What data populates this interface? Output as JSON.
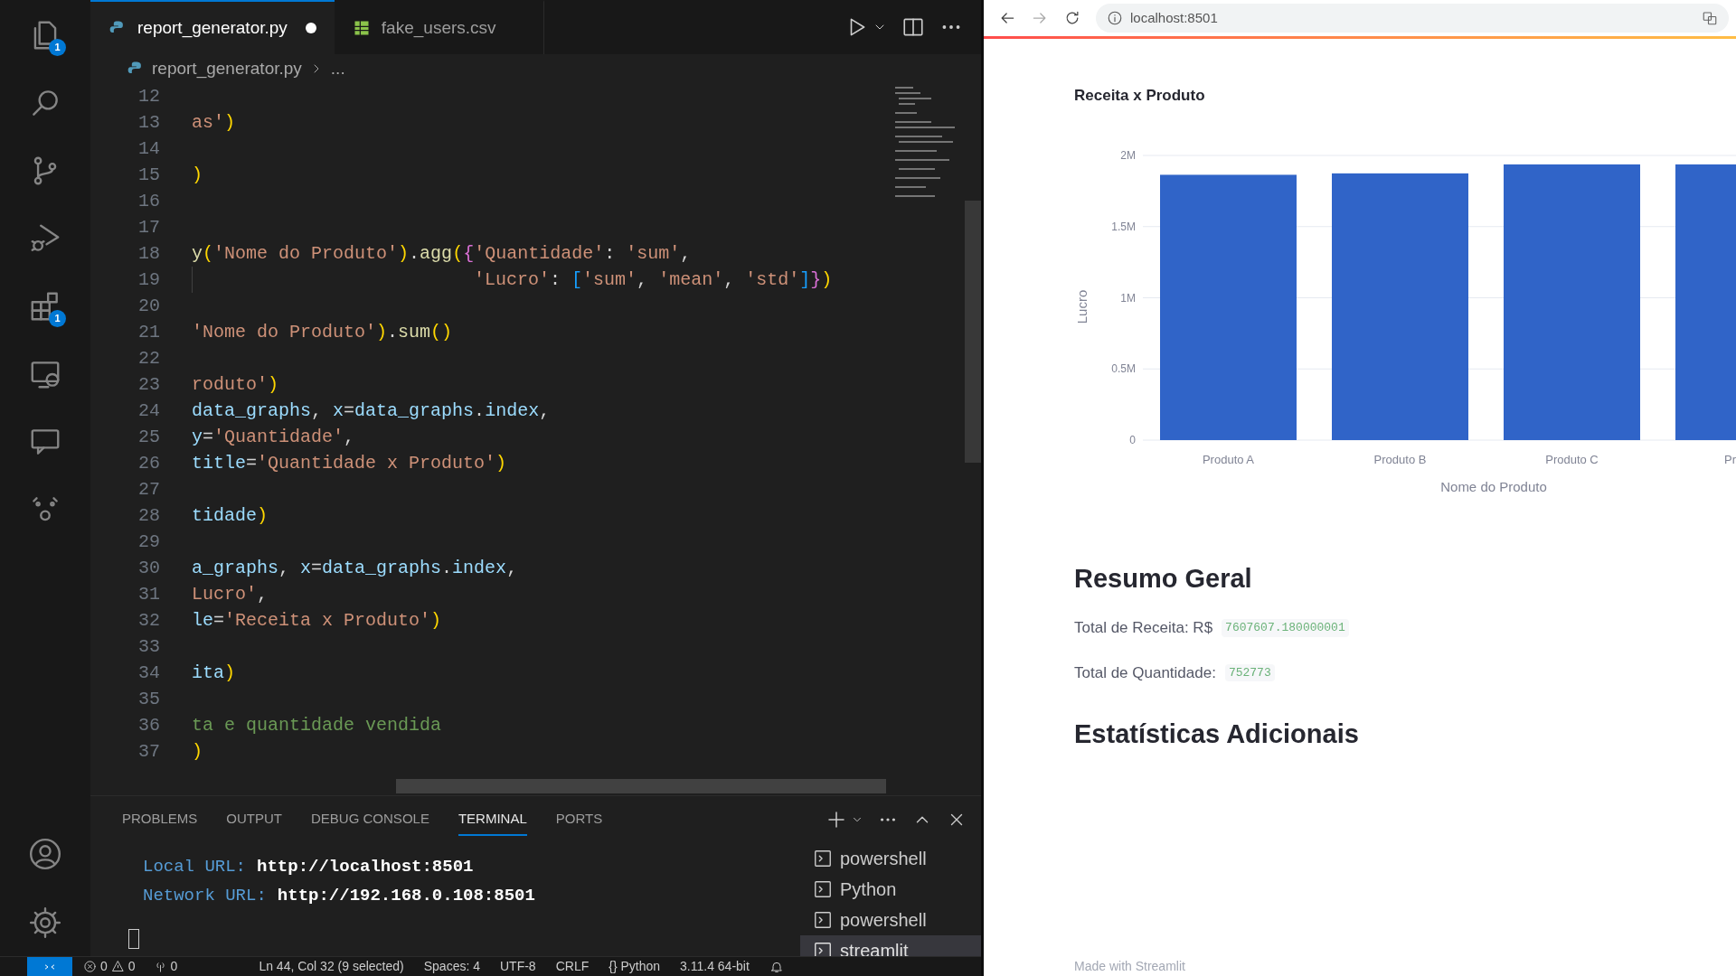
{
  "activity_bar": {
    "top": [
      {
        "kind": "explorer",
        "badge": "1"
      },
      {
        "kind": "search"
      },
      {
        "kind": "source-control"
      },
      {
        "kind": "run-debug"
      },
      {
        "kind": "extensions",
        "badge": "1"
      },
      {
        "kind": "remote"
      },
      {
        "kind": "chat"
      },
      {
        "kind": "bot"
      }
    ],
    "bottom": [
      {
        "kind": "account"
      },
      {
        "kind": "settings"
      }
    ]
  },
  "editor_tabs": [
    {
      "label": "report_generator.py",
      "kind": "python",
      "selected": true,
      "modified": true
    },
    {
      "label": "fake_users.csv",
      "kind": "csv",
      "selected": false,
      "modified": false
    }
  ],
  "breadcrumb": {
    "file": "report_generator.py",
    "rest": "..."
  },
  "code_lines": [
    {
      "number": "12"
    },
    {
      "number": "13",
      "tokens": [
        {
          "text": "as'",
          "kind": "string"
        },
        {
          "text": ")",
          "kind": "paren"
        }
      ]
    },
    {
      "number": "14"
    },
    {
      "number": "15",
      "tokens": [
        {
          "text": ")",
          "kind": "paren"
        }
      ]
    },
    {
      "number": "16"
    },
    {
      "number": "17"
    },
    {
      "number": "18",
      "tokens": [
        {
          "text": "y",
          "kind": "func"
        },
        {
          "text": "(",
          "kind": "paren"
        },
        {
          "text": "'Nome do Produto'",
          "kind": "string"
        },
        {
          "text": ")",
          "kind": "paren"
        },
        {
          "text": ".",
          "kind": "punct"
        },
        {
          "text": "agg",
          "kind": "func"
        },
        {
          "text": "(",
          "kind": "paren"
        },
        {
          "text": "{",
          "kind": "brace"
        },
        {
          "text": "'Quantidade'",
          "kind": "string"
        },
        {
          "text": ": ",
          "kind": "punct"
        },
        {
          "text": "'sum'",
          "kind": "string"
        },
        {
          "text": ",",
          "kind": "punct"
        }
      ]
    },
    {
      "number": "19",
      "continuation": true,
      "tokens": [
        {
          "text": "'Lucro'",
          "kind": "string"
        },
        {
          "text": ": ",
          "kind": "punct"
        },
        {
          "text": "[",
          "kind": "bracket"
        },
        {
          "text": "'sum'",
          "kind": "string"
        },
        {
          "text": ", ",
          "kind": "punct"
        },
        {
          "text": "'mean'",
          "kind": "string"
        },
        {
          "text": ", ",
          "kind": "punct"
        },
        {
          "text": "'std'",
          "kind": "string"
        },
        {
          "text": "]",
          "kind": "bracket"
        },
        {
          "text": "}",
          "kind": "brace"
        },
        {
          "text": ")",
          "kind": "paren"
        }
      ]
    },
    {
      "number": "20"
    },
    {
      "number": "21",
      "tokens": [
        {
          "text": "'Nome do Produto'",
          "kind": "string"
        },
        {
          "text": ")",
          "kind": "paren"
        },
        {
          "text": ".",
          "kind": "punct"
        },
        {
          "text": "sum",
          "kind": "func"
        },
        {
          "text": "()",
          "kind": "paren"
        }
      ]
    },
    {
      "number": "22"
    },
    {
      "number": "23",
      "tokens": [
        {
          "text": "roduto'",
          "kind": "string"
        },
        {
          "text": ")",
          "kind": "paren"
        }
      ]
    },
    {
      "number": "24",
      "tokens": [
        {
          "text": "data_graphs",
          "kind": "var"
        },
        {
          "text": ", ",
          "kind": "punct"
        },
        {
          "text": "x",
          "kind": "var"
        },
        {
          "text": "=",
          "kind": "punct"
        },
        {
          "text": "data_graphs",
          "kind": "var"
        },
        {
          "text": ".",
          "kind": "punct"
        },
        {
          "text": "index",
          "kind": "var"
        },
        {
          "text": ",",
          "kind": "punct"
        }
      ]
    },
    {
      "number": "25",
      "tokens": [
        {
          "text": "y",
          "kind": "var"
        },
        {
          "text": "=",
          "kind": "punct"
        },
        {
          "text": "'Quantidade'",
          "kind": "string"
        },
        {
          "text": ",",
          "kind": "punct"
        }
      ]
    },
    {
      "number": "26",
      "tokens": [
        {
          "text": "title",
          "kind": "var"
        },
        {
          "text": "=",
          "kind": "punct"
        },
        {
          "text": "'Quantidade x Produto'",
          "kind": "string"
        },
        {
          "text": ")",
          "kind": "paren"
        }
      ]
    },
    {
      "number": "27"
    },
    {
      "number": "28",
      "tokens": [
        {
          "text": "tidade",
          "kind": "var"
        },
        {
          "text": ")",
          "kind": "paren"
        }
      ]
    },
    {
      "number": "29"
    },
    {
      "number": "30",
      "tokens": [
        {
          "text": "a_graphs",
          "kind": "var"
        },
        {
          "text": ", ",
          "kind": "punct"
        },
        {
          "text": "x",
          "kind": "var"
        },
        {
          "text": "=",
          "kind": "punct"
        },
        {
          "text": "data_graphs",
          "kind": "var"
        },
        {
          "text": ".",
          "kind": "punct"
        },
        {
          "text": "index",
          "kind": "var"
        },
        {
          "text": ",",
          "kind": "punct"
        }
      ]
    },
    {
      "number": "31",
      "tokens": [
        {
          "text": "Lucro'",
          "kind": "string"
        },
        {
          "text": ",",
          "kind": "punct"
        }
      ]
    },
    {
      "number": "32",
      "tokens": [
        {
          "text": "le",
          "kind": "var"
        },
        {
          "text": "=",
          "kind": "punct"
        },
        {
          "text": "'Receita x Produto'",
          "kind": "string"
        },
        {
          "text": ")",
          "kind": "paren"
        }
      ]
    },
    {
      "number": "33"
    },
    {
      "number": "34",
      "tokens": [
        {
          "text": "ita",
          "kind": "var"
        },
        {
          "text": ")",
          "kind": "paren"
        }
      ]
    },
    {
      "number": "35"
    },
    {
      "number": "36",
      "tokens": [
        {
          "text": "ta e quantidade vendida",
          "kind": "comment"
        }
      ]
    },
    {
      "number": "37",
      "tokens": [
        {
          "text": ")",
          "kind": "paren"
        }
      ]
    }
  ],
  "panel_tabs": [
    {
      "label": "PROBLEMS",
      "selected": false
    },
    {
      "label": "OUTPUT",
      "selected": false
    },
    {
      "label": "DEBUG CONSOLE",
      "selected": false
    },
    {
      "label": "TERMINAL",
      "selected": true
    },
    {
      "label": "PORTS",
      "selected": false
    }
  ],
  "terminal_lines": [
    {
      "label": "Local URL:",
      "value": "http://localhost:8501"
    },
    {
      "label": "Network URL:",
      "value": "http://192.168.0.108:8501"
    }
  ],
  "terminals": [
    {
      "label": "powershell",
      "selected": false
    },
    {
      "label": "Python",
      "selected": false
    },
    {
      "label": "powershell",
      "selected": false
    },
    {
      "label": "streamlit",
      "selected": true
    }
  ],
  "status_bar": {
    "errors": "0",
    "warnings": "0",
    "ports": "0",
    "items": [
      "Ln 44, Col 32 (9 selected)",
      "Spaces: 4",
      "UTF-8",
      "CRLF",
      "{} Python",
      "3.11.4 64-bit"
    ]
  },
  "browser": {
    "url": "localhost:8501",
    "chart_data": {
      "type": "bar",
      "title": "Receita x Produto",
      "xlabel": "Nome do Produto",
      "ylabel": "Lucro",
      "categories": [
        "Produto A",
        "Produto B",
        "Produto C",
        "Pr"
      ],
      "series": [
        {
          "color": "#3064c8",
          "values": [
            1864000,
            1874000,
            1937000,
            1937000
          ]
        }
      ],
      "grid": true,
      "ylim": [
        0,
        2000000
      ],
      "yticks": [
        {
          "value": 0,
          "label": "0"
        },
        {
          "value": 500000,
          "label": "0.5M"
        },
        {
          "value": 1000000,
          "label": "1M"
        },
        {
          "value": 1500000,
          "label": "1.5M"
        },
        {
          "value": 2000000,
          "label": "2M"
        }
      ]
    },
    "content": [
      {
        "kind": "heading",
        "text": "Resumo Geral"
      },
      {
        "kind": "metric",
        "label": "Total de Receita: R$",
        "value": "7607607.180000001"
      },
      {
        "kind": "metric",
        "label": "Total de Quantidade:",
        "value": "752773"
      },
      {
        "kind": "heading",
        "text": "Estatísticas Adicionais"
      }
    ],
    "footer": "Made with Streamlit"
  }
}
